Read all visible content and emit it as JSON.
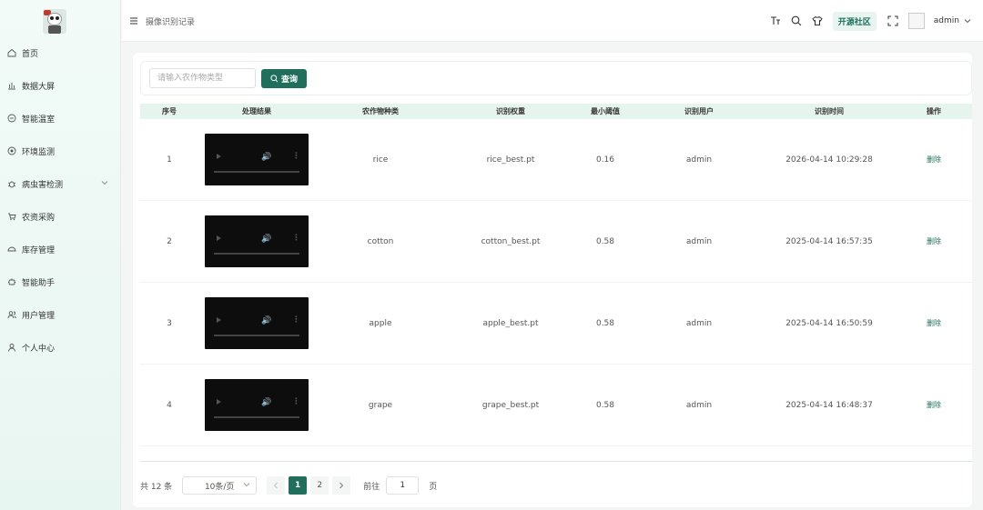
{
  "app": {
    "breadcrumb": "摄像识别记录",
    "community": "开源社区",
    "user": "admin"
  },
  "sidebar": {
    "items": [
      {
        "label": "首页",
        "icon": "home-icon"
      },
      {
        "label": "数据大屏",
        "icon": "bar-chart-icon"
      },
      {
        "label": "智能温室",
        "icon": "greenhouse-icon"
      },
      {
        "label": "环境监测",
        "icon": "monitor-icon"
      },
      {
        "label": "病虫害检测",
        "icon": "bug-icon",
        "expandable": true
      },
      {
        "label": "农资采购",
        "icon": "cart-icon"
      },
      {
        "label": "库存管理",
        "icon": "inventory-icon"
      },
      {
        "label": "智能助手",
        "icon": "assistant-icon"
      },
      {
        "label": "用户管理",
        "icon": "users-icon"
      },
      {
        "label": "个人中心",
        "icon": "profile-icon"
      }
    ]
  },
  "search": {
    "placeholder": "请输入农作物类型",
    "button": "查询"
  },
  "table": {
    "headers": [
      "序号",
      "处理结果",
      "农作物种类",
      "识别权重",
      "最小阈值",
      "识别用户",
      "识别时间",
      "操作"
    ],
    "rows": [
      {
        "index": "1",
        "crop": "rice",
        "weight": "rice_best.pt",
        "threshold": "0.16",
        "user": "admin",
        "time": "2026-04-14 10:29:28",
        "action": "删除"
      },
      {
        "index": "2",
        "crop": "cotton",
        "weight": "cotton_best.pt",
        "threshold": "0.58",
        "user": "admin",
        "time": "2025-04-14 16:57:35",
        "action": "删除"
      },
      {
        "index": "3",
        "crop": "apple",
        "weight": "apple_best.pt",
        "threshold": "0.58",
        "user": "admin",
        "time": "2025-04-14 16:50:59",
        "action": "删除"
      },
      {
        "index": "4",
        "crop": "grape",
        "weight": "grape_best.pt",
        "threshold": "0.58",
        "user": "admin",
        "time": "2025-04-14 16:48:37",
        "action": "删除"
      }
    ]
  },
  "pagination": {
    "total": "共 12 条",
    "page_size": "10条/页",
    "pages": [
      "1",
      "2"
    ],
    "current": "1",
    "goto_label": "前往",
    "goto_value": "1",
    "page_suffix": "页"
  },
  "colors": {
    "accent": "#1f6f5c",
    "header_row": "#e6f4ee"
  }
}
